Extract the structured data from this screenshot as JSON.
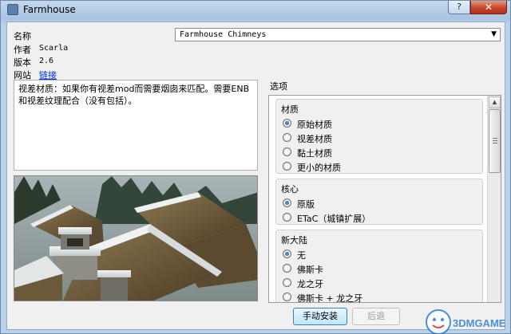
{
  "window": {
    "title": "Farmhouse",
    "help_glyph": "?",
    "close_glyph": "✕"
  },
  "info": {
    "name_label": "名称",
    "author_label": "作者",
    "author_value": "Scarla",
    "version_label": "版本",
    "version_value": "2.6",
    "website_label": "网站",
    "website_link": "链接"
  },
  "plugin_select": {
    "value": "Farmhouse Chimneys",
    "arrow": "▼"
  },
  "description": "视差材质：如果你有视差mod而需要烟囱来匹配。需要ENB和视差纹理配合（没有包括）。",
  "options": {
    "title": "选项",
    "groups": [
      {
        "title": "材质",
        "items": [
          {
            "label": "原始材质",
            "checked": true
          },
          {
            "label": "视差材质",
            "checked": false
          },
          {
            "label": "黏土材质",
            "checked": false
          },
          {
            "label": "更小的材质",
            "checked": false
          }
        ]
      },
      {
        "title": "核心",
        "items": [
          {
            "label": "原版",
            "checked": true
          },
          {
            "label": "ETaC（城镇扩展）",
            "checked": false
          }
        ]
      },
      {
        "title": "新大陆",
        "items": [
          {
            "label": "无",
            "checked": true
          },
          {
            "label": "佛斯卡",
            "checked": false
          },
          {
            "label": "龙之牙",
            "checked": false
          },
          {
            "label": "佛斯卡 + 龙之牙",
            "checked": false
          }
        ]
      }
    ]
  },
  "buttons": {
    "manual_install": "手动安装",
    "back": "后退"
  },
  "watermark": {
    "text": "3DMGAME"
  }
}
